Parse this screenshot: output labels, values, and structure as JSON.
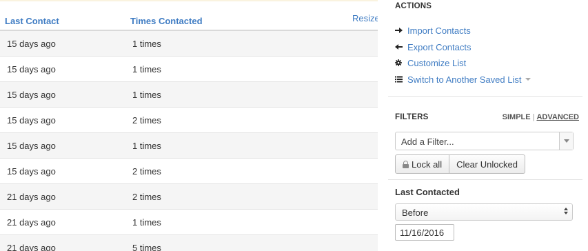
{
  "table": {
    "columns": {
      "last_contact": "Last Contact",
      "times_contacted": "Times Contacted"
    },
    "resize_label": "Resize",
    "rows": [
      {
        "last_contact": "15 days ago",
        "times": "1 times"
      },
      {
        "last_contact": "15 days ago",
        "times": "1 times"
      },
      {
        "last_contact": "15 days ago",
        "times": "1 times"
      },
      {
        "last_contact": "15 days ago",
        "times": "2 times"
      },
      {
        "last_contact": "15 days ago",
        "times": "1 times"
      },
      {
        "last_contact": "15 days ago",
        "times": "2 times"
      },
      {
        "last_contact": "21 days ago",
        "times": "2 times"
      },
      {
        "last_contact": "21 days ago",
        "times": "1 times"
      },
      {
        "last_contact": "21 days ago",
        "times": "5 times"
      }
    ]
  },
  "actions": {
    "heading": "ACTIONS",
    "items": [
      {
        "label": "Import Contacts",
        "icon": "arrow-right-icon"
      },
      {
        "label": "Export Contacts",
        "icon": "arrow-left-icon"
      },
      {
        "label": "Customize List",
        "icon": "gear-icon"
      },
      {
        "label": "Switch to Another Saved List",
        "icon": "list-icon"
      }
    ]
  },
  "filters": {
    "heading": "FILTERS",
    "mode_simple": "SIMPLE",
    "mode_separator": "|",
    "mode_advanced": "ADVANCED",
    "add_filter_placeholder": "Add a Filter...",
    "lock_all_label": "Lock all",
    "clear_unlocked_label": "Clear Unlocked",
    "last_contacted_label": "Last Contacted",
    "comparison_value": "Before",
    "date_value": "11/16/2016"
  },
  "colors": {
    "link": "#3f7cc3",
    "row_stripe": "#f5f5f5",
    "top_rule": "#faf3df"
  }
}
